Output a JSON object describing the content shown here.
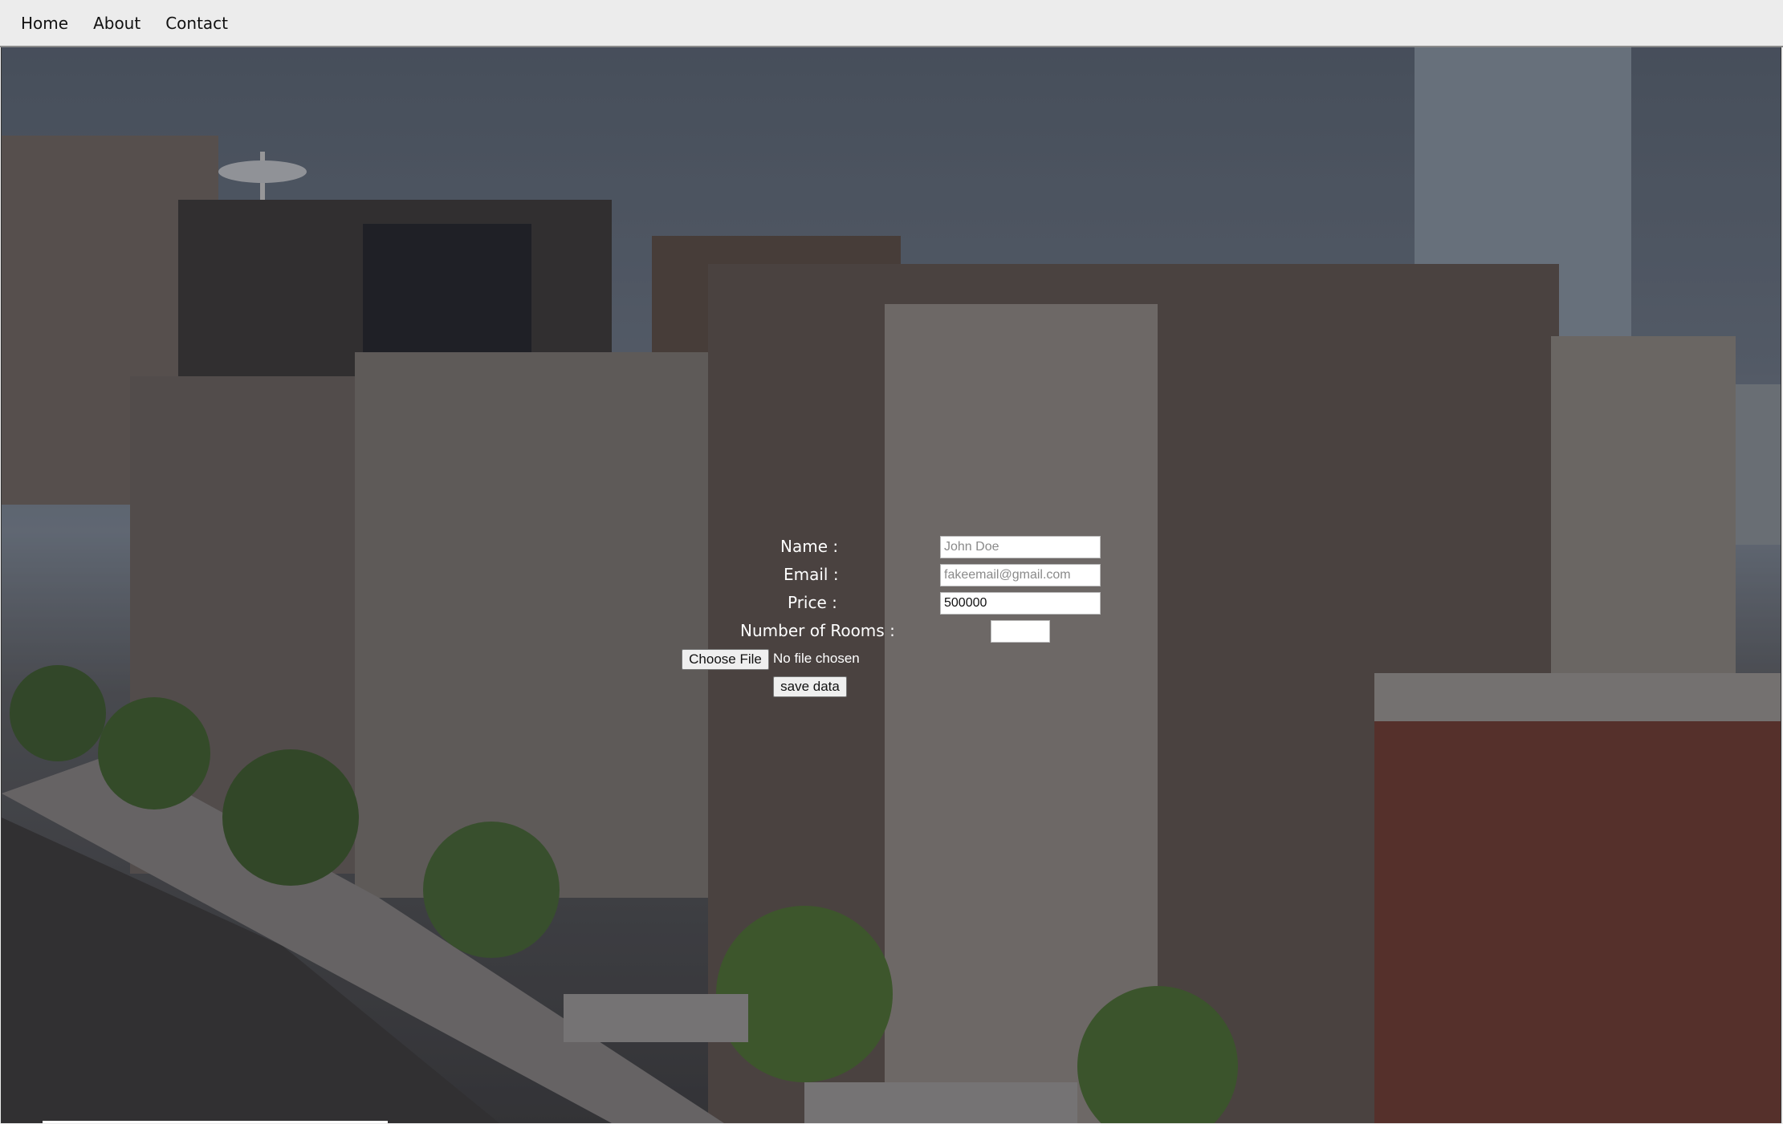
{
  "nav": {
    "items": [
      {
        "label": "Home"
      },
      {
        "label": "About"
      },
      {
        "label": "Contact"
      }
    ]
  },
  "form": {
    "name_label": "Name :",
    "name_placeholder": "John Doe",
    "email_label": "Email :",
    "email_placeholder": "fakeemail@gmail.com",
    "price_label": "Price :",
    "price_value": "500000",
    "rooms_label": "Number of Rooms :",
    "rooms_value": "",
    "file_button": "Choose File",
    "file_status": "No file chosen",
    "submit_label": "save data"
  },
  "colors": {
    "nav_bg": "#ececec",
    "label_text": "#ffffff"
  }
}
